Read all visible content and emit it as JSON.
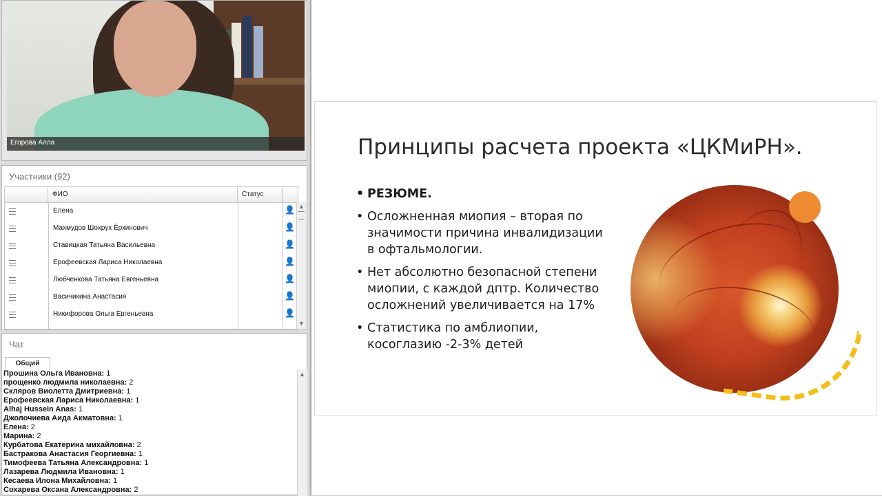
{
  "video": {
    "presenter_name": "Егорова Алла"
  },
  "participants": {
    "title": "Участники (92)",
    "columns": [
      "ФИО",
      "Статус"
    ],
    "rows": [
      "Елена",
      "Махмудов Шохрух Ёркинович",
      "Ставицкая Татьяна Васильевна",
      "Ерофеевская Лариса  Николаевна",
      "Любченкова Татьяна Евгеньевна",
      "Васичикина Анастасия",
      "Никифорова Ольга Евгеньевна"
    ]
  },
  "chat": {
    "title": "Чат",
    "tab_label": "Общий",
    "messages": [
      {
        "author": "Прошина Ольга  Ивановна:",
        "text": "1"
      },
      {
        "author": "прощенко людмила николаевна:",
        "text": "2"
      },
      {
        "author": "Скляров Виолетта Дмитриевна:",
        "text": "1"
      },
      {
        "author": "Ерофеевская Лариса  Николаевна:",
        "text": "1"
      },
      {
        "author": "Alhaj Hussein  Anas:",
        "text": "1"
      },
      {
        "author": "Джолочиева Аида  Акматовна:",
        "text": "1"
      },
      {
        "author": "Елена:",
        "text": "2"
      },
      {
        "author": "Марина:",
        "text": "2"
      },
      {
        "author": "Курбатова  Екатерина михайловна:",
        "text": "2"
      },
      {
        "author": "Бастракова Анастасия Георгиевна:",
        "text": "1"
      },
      {
        "author": "Тимофеева Татьяна  Александровна:",
        "text": "1"
      },
      {
        "author": "Лазарева Людмила  Ивановна:",
        "text": "1"
      },
      {
        "author": "Кесаева Илона    Михайловна:",
        "text": "1"
      },
      {
        "author": "Сохарева Оксана Александровна:",
        "text": "2"
      }
    ]
  },
  "slide": {
    "title": "Принципы расчета проекта «ЦКМиРН».",
    "bullets": [
      {
        "text": "РЕЗЮМЕ.",
        "bold": true
      },
      {
        "text": "Осложненная миопия – вторая по значимости причина инвалидизации в офтальмологии.",
        "bold": false
      },
      {
        "text": "Нет абсолютно  безопасной степени миопии, с каждой дптр. Количество осложнений увеличивается на 17%",
        "bold": false
      },
      {
        "text": "Статистика по амблиопии, косоглазию -2-3% детей",
        "bold": false
      }
    ],
    "accent_orange": "#ee8a2f",
    "accent_yellow": "#f4be1a"
  }
}
